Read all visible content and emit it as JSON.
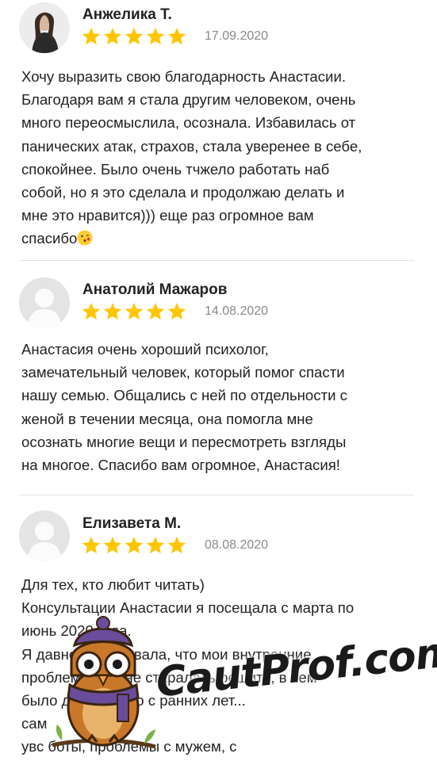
{
  "colors": {
    "star": "#FFC600",
    "date": "#8a8a8a",
    "divider": "#e2e2e2",
    "owl_body": "#c9782a",
    "owl_scarf": "#6a4c9c"
  },
  "reviews": [
    {
      "author": "Анжелика Т.",
      "rating": 5,
      "date": "17.09.2020",
      "avatar": "photo-avatar",
      "text": "Хочу выразить свою благодарность Анастасии.\nБлагодаря вам я стала другим человеком, очень\nмного переосмыслила, осознала. Избавилась от\nпанических атак, страхов, стала уверенее в себе,\nспокойнее. Было очень тчжело работать наб\nсобой, но я это сделала и продолжаю делать и\nмне это нравится))) еще раз огромное вам\nспасибо",
      "emoji": "kissing-face-emoji"
    },
    {
      "author": "Анатолий Мажаров",
      "rating": 5,
      "date": "14.08.2020",
      "avatar": "default-avatar",
      "text": "Анастасия очень хороший психолог,\nзамечательный человек, который помог спасти\nнашу семью. Общались с ней по отдельности с\nженой в течении месяца, она помогла мне\nосознать многие вещи и пересмотреть взгляды\nна многое. Спасибо вам огромное, Анастасия!"
    },
    {
      "author": "Елизавета М.",
      "rating": 5,
      "date": "08.08.2020",
      "avatar": "default-avatar",
      "text": "Для тех, кто любит читать)\nКонсультации Анастасии я посещала с марта по\nиюнь 2020 года.\nЯ давно чувствовала, что мои внутренние\nпроблемы, как не старалась решить, в чем\nбыло дело, давно с ранних лет...\nсам\nувс                    боты, проблемы с мужем, с"
    }
  ],
  "watermark": {
    "text": "CautProf.com",
    "icon": "owl-icon"
  }
}
